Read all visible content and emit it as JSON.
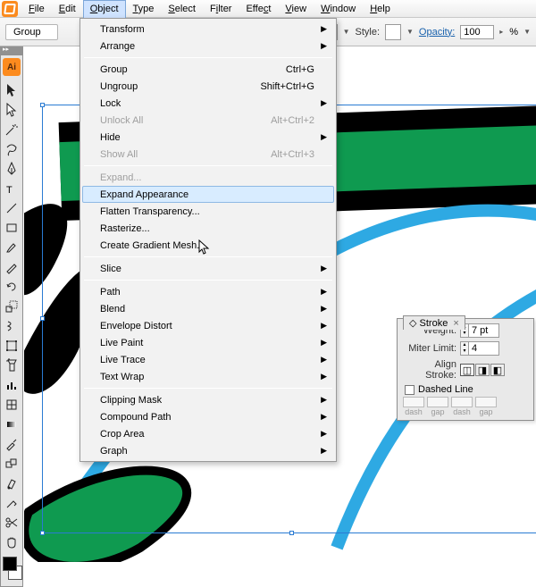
{
  "menubar": {
    "items": [
      "File",
      "Edit",
      "Object",
      "Type",
      "Select",
      "Filter",
      "Effect",
      "View",
      "Window",
      "Help"
    ],
    "open_index": 2
  },
  "subbar": {
    "group_label": "Group",
    "style_label": "Style:",
    "opacity_label": "Opacity:",
    "opacity_value": "100",
    "percent": "%"
  },
  "dropdown": {
    "hover_index": 9,
    "items": [
      {
        "label": "Transform",
        "sub": true
      },
      {
        "label": "Arrange",
        "sub": true
      },
      {
        "sep": true
      },
      {
        "label": "Group",
        "short": "Ctrl+G"
      },
      {
        "label": "Ungroup",
        "short": "Shift+Ctrl+G"
      },
      {
        "label": "Lock",
        "sub": true
      },
      {
        "label": "Unlock All",
        "short": "Alt+Ctrl+2",
        "disabled": true
      },
      {
        "label": "Hide",
        "sub": true
      },
      {
        "label": "Show All",
        "short": "Alt+Ctrl+3",
        "disabled": true
      },
      {
        "sep": true
      },
      {
        "label": "Expand...",
        "disabled": true
      },
      {
        "label": "Expand Appearance"
      },
      {
        "label": "Flatten Transparency..."
      },
      {
        "label": "Rasterize..."
      },
      {
        "label": "Create Gradient Mesh..."
      },
      {
        "sep": true
      },
      {
        "label": "Slice",
        "sub": true
      },
      {
        "sep": true
      },
      {
        "label": "Path",
        "sub": true
      },
      {
        "label": "Blend",
        "sub": true
      },
      {
        "label": "Envelope Distort",
        "sub": true
      },
      {
        "label": "Live Paint",
        "sub": true
      },
      {
        "label": "Live Trace",
        "sub": true
      },
      {
        "label": "Text Wrap",
        "sub": true
      },
      {
        "sep": true
      },
      {
        "label": "Clipping Mask",
        "sub": true
      },
      {
        "label": "Compound Path",
        "sub": true
      },
      {
        "label": "Crop Area",
        "sub": true
      },
      {
        "label": "Graph",
        "sub": true
      }
    ]
  },
  "toolbox": {
    "logo": "Ai"
  },
  "stroke_panel": {
    "title": "Stroke",
    "weight_label": "Weight:",
    "weight_value": "7 pt",
    "miter_label": "Miter Limit:",
    "miter_value": "4",
    "align_label": "Align Stroke:",
    "dashed_label": "Dashed Line",
    "dash_labels": [
      "dash",
      "gap",
      "dash",
      "gap"
    ]
  }
}
